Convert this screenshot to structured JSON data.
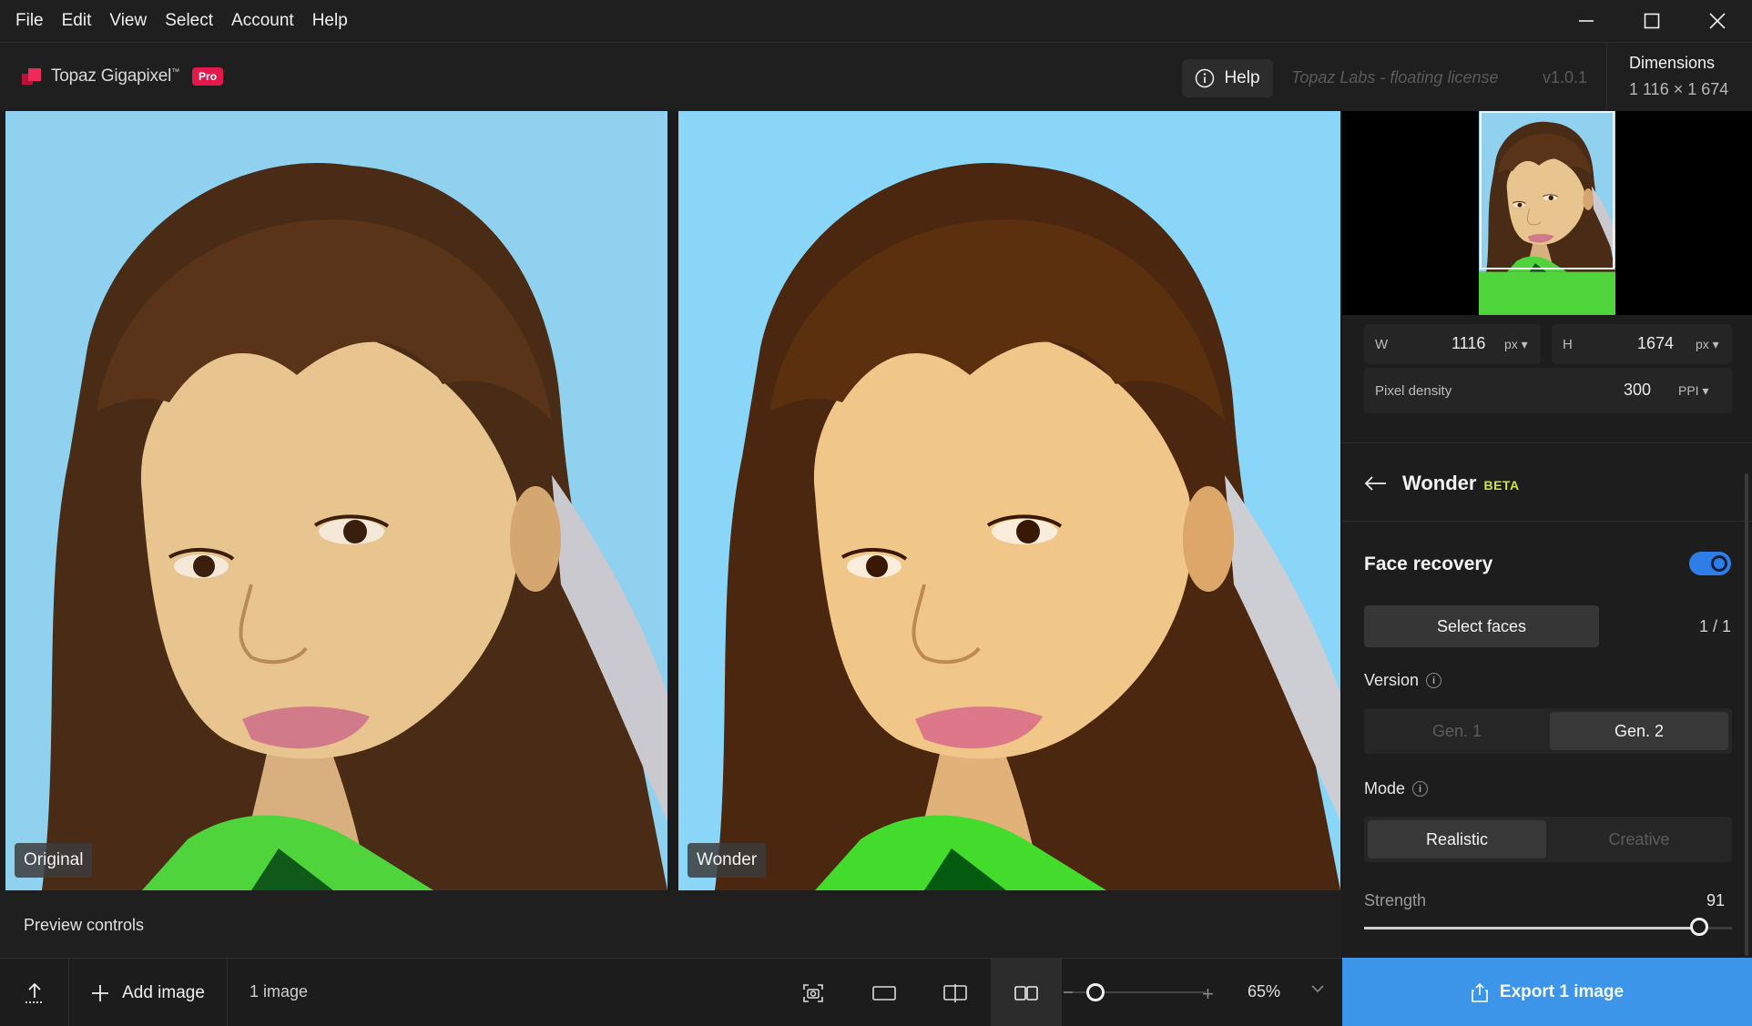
{
  "menu": [
    "File",
    "Edit",
    "View",
    "Select",
    "Account",
    "Help"
  ],
  "app": {
    "name": "Topaz Gigapixel",
    "trademark": "™",
    "badge": "Pro",
    "help_label": "Help",
    "license": "Topaz Labs - floating license",
    "version": "v1.0.1"
  },
  "dimensions": {
    "title": "Dimensions",
    "value": "1 116 × 1 674"
  },
  "panes": {
    "left_label": "Original",
    "right_label": "Wonder"
  },
  "preview_controls_label": "Preview controls",
  "bottom": {
    "add_label": "Add image",
    "count": "1 image",
    "zoom": "65%",
    "zoom_level": 0.1
  },
  "size": {
    "w_label": "W",
    "w_value": "1116",
    "w_unit": "px",
    "h_label": "H",
    "h_value": "1674",
    "h_unit": "px",
    "density_label": "Pixel density",
    "density_value": "300",
    "density_unit": "PPI"
  },
  "wonder": {
    "title": "Wonder",
    "badge": "BETA",
    "face_recovery": "Face recovery",
    "face_recovery_on": true,
    "select_faces": "Select faces",
    "faces_count": "1 / 1",
    "version_label": "Version",
    "version_options": [
      "Gen. 1",
      "Gen. 2"
    ],
    "version_selected": "Gen. 2",
    "mode_label": "Mode",
    "mode_options": [
      "Realistic",
      "Creative"
    ],
    "mode_selected": "Realistic",
    "strength_label": "Strength",
    "strength_value": "91"
  },
  "export_label": "Export 1 image",
  "colors": {
    "accent": "#3c95e8",
    "toggle": "#2f7ee8",
    "pro": "#e2194a",
    "beta": "#c9e83a"
  },
  "icons": [
    "close-icon",
    "maximize-icon",
    "minimize-icon",
    "info-icon",
    "back-arrow-icon",
    "upload-icon",
    "plus-icon",
    "screenshot-icon",
    "single-view-icon",
    "split-view-icon",
    "side-by-side-icon",
    "chevron-down-icon",
    "share-icon"
  ]
}
